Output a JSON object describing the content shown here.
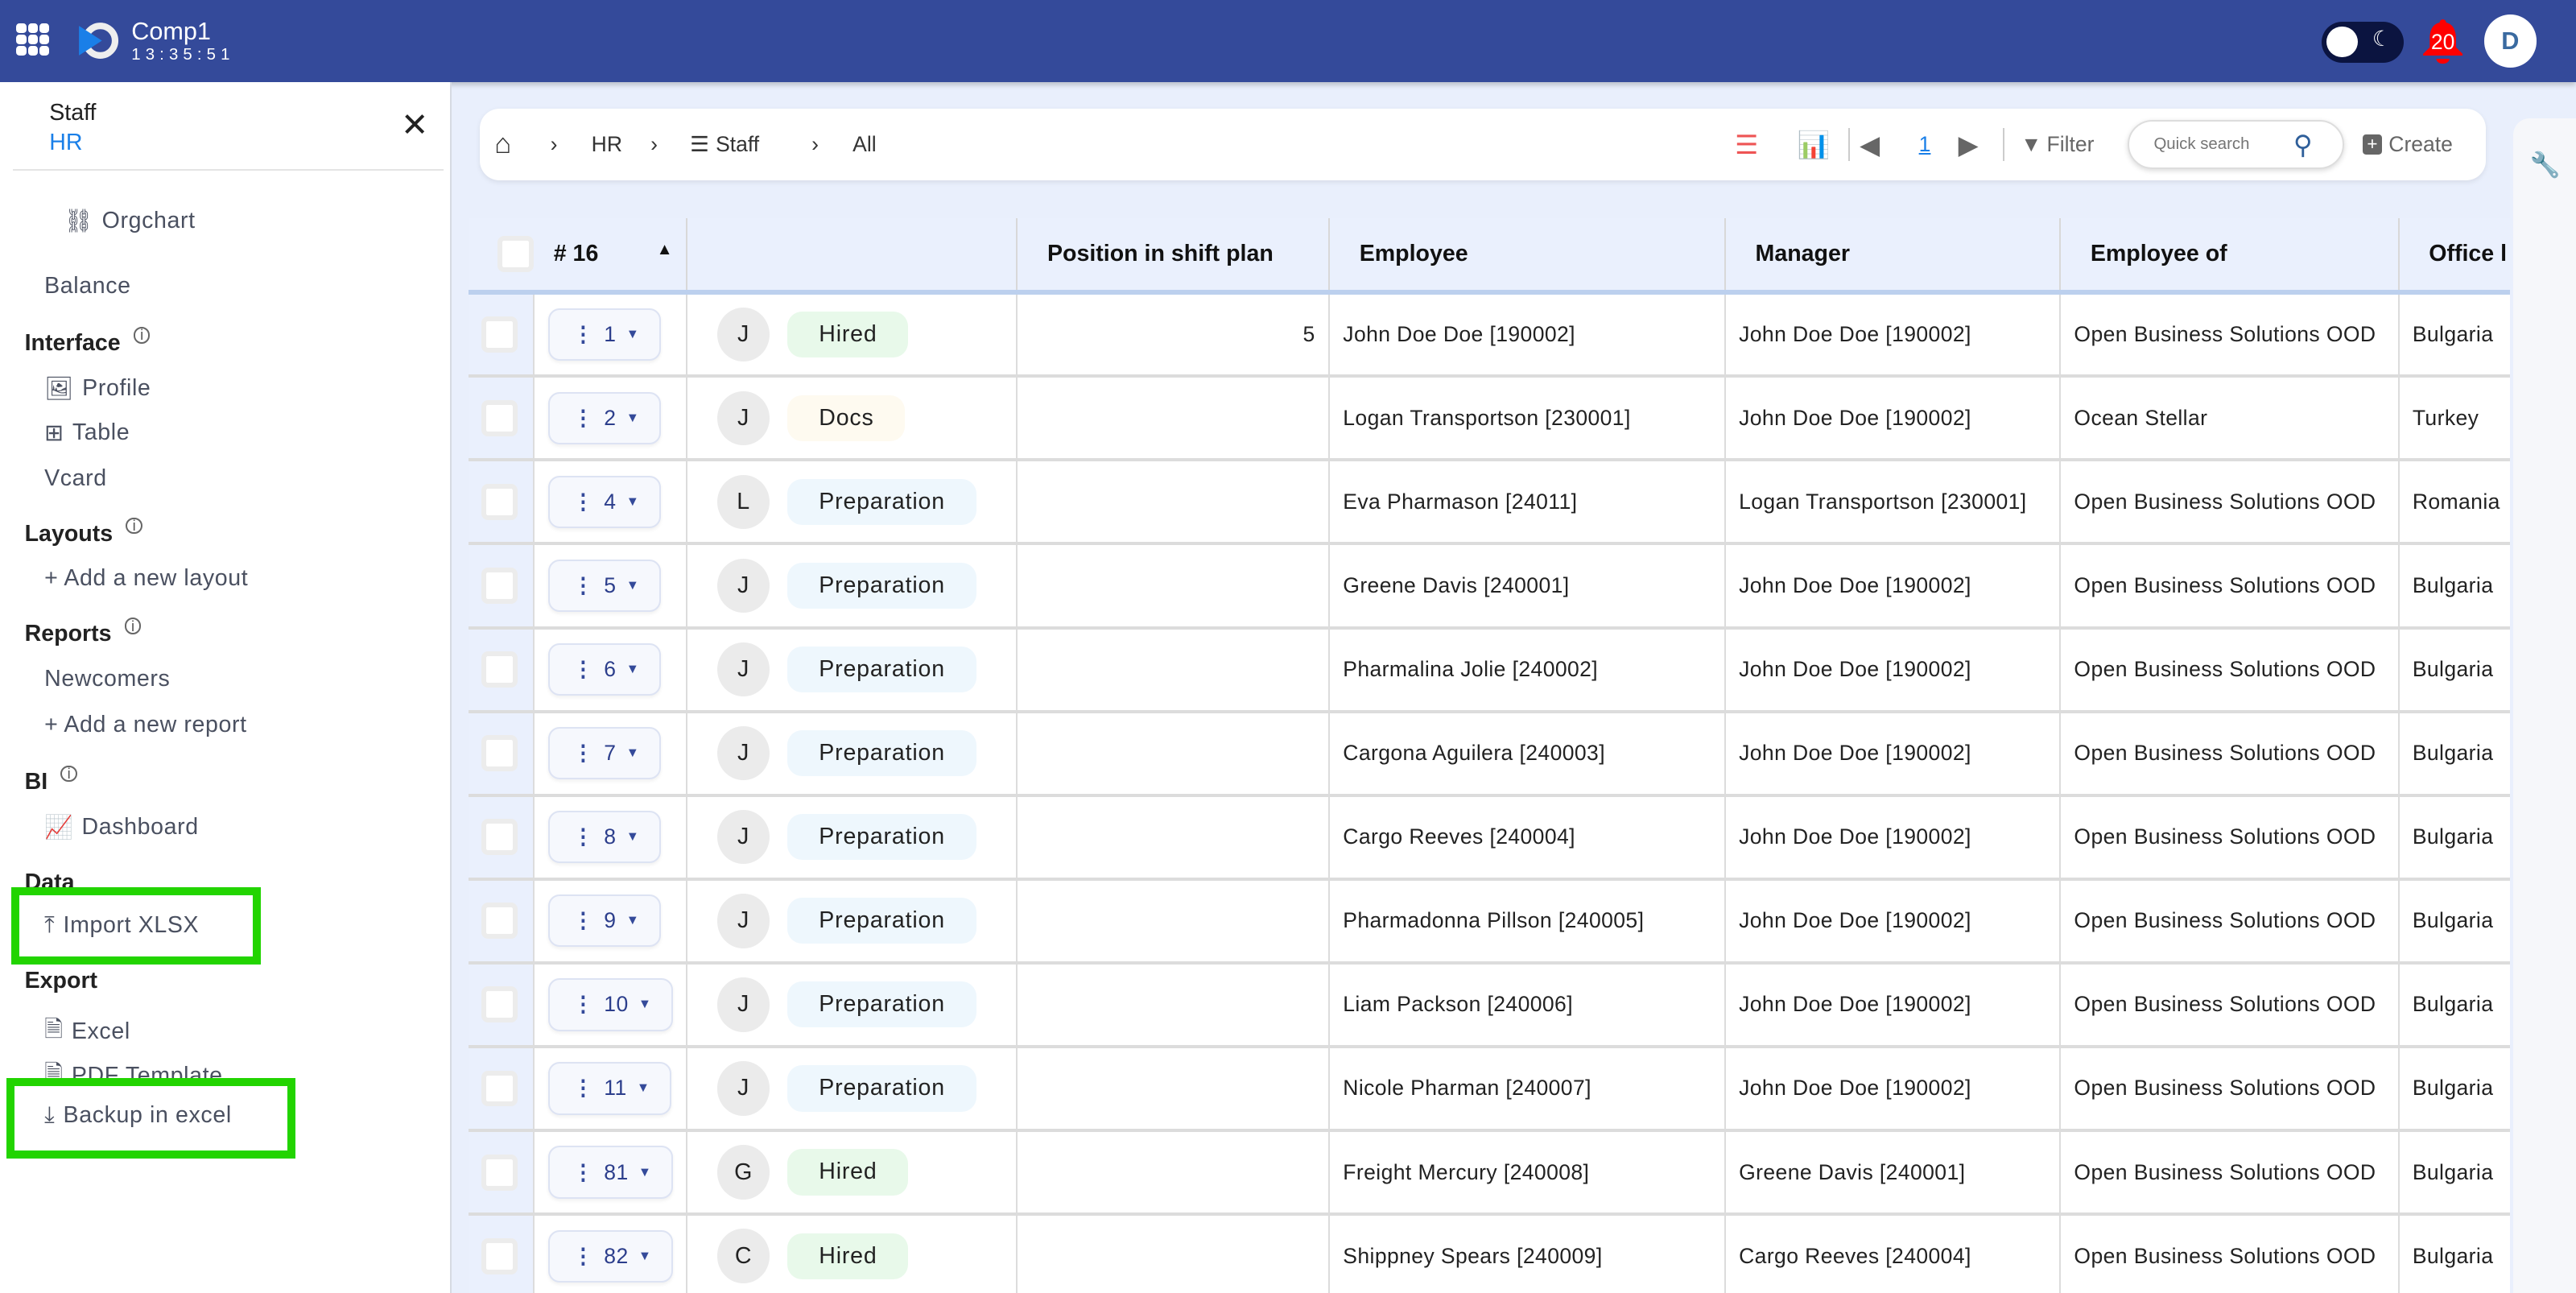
{
  "header": {
    "company": "Comp1",
    "clock": "13:35:51",
    "notifications": "20",
    "avatar": "D",
    "icons": [
      "apps-grid-icon",
      "logo-icon",
      "theme-toggle",
      "moon-icon",
      "bell-icon"
    ]
  },
  "sidebar": {
    "title": "Staff",
    "subtitle": "HR",
    "items": {
      "orgchart": "Orgchart",
      "balance": "Balance",
      "interface": "Interface",
      "profile": "Profile",
      "table": "Table",
      "vcard": "Vcard",
      "layouts": "Layouts",
      "add_layout": "+ Add a new layout",
      "reports": "Reports",
      "newcomers": "Newcomers",
      "add_report": "+ Add a new report",
      "bi": "BI",
      "dashboard": "Dashboard",
      "data": "Data",
      "import": "Import XLSX",
      "export": "Export",
      "excel": "Excel",
      "pdf": "PDF Template",
      "backup": "Backup in excel"
    }
  },
  "breadcrumb": {
    "hr": "HR",
    "staff": "Staff",
    "all": "All"
  },
  "toolbar": {
    "page": "1",
    "filter": "Filter",
    "search_placeholder": "Quick search",
    "create": "Create"
  },
  "table": {
    "count_header": "# 16",
    "columns": [
      "Position in shift plan",
      "Employee",
      "Manager",
      "Employee of",
      "Office l"
    ],
    "status_colors": {
      "Hired": "#e8f9ea",
      "Docs": "#fefaf0",
      "Preparation": "#eef7fd"
    },
    "rows": [
      {
        "num": "1",
        "initial": "J",
        "status": "Hired",
        "position": "5",
        "employee": "John Doe Doe [190002]",
        "manager": "John Doe Doe [190002]",
        "employer": "Open Business Solutions OOD",
        "office": "Bulgaria"
      },
      {
        "num": "2",
        "initial": "J",
        "status": "Docs",
        "position": "",
        "employee": "Logan Transportson [230001]",
        "manager": "John Doe Doe [190002]",
        "employer": "Ocean Stellar",
        "office": "Turkey"
      },
      {
        "num": "4",
        "initial": "L",
        "status": "Preparation",
        "position": "",
        "employee": "Eva Pharmason [24011]",
        "manager": "Logan Transportson [230001]",
        "employer": "Open Business Solutions OOD",
        "office": "Romania"
      },
      {
        "num": "5",
        "initial": "J",
        "status": "Preparation",
        "position": "",
        "employee": "Greene Davis [240001]",
        "manager": "John Doe Doe [190002]",
        "employer": "Open Business Solutions OOD",
        "office": "Bulgaria"
      },
      {
        "num": "6",
        "initial": "J",
        "status": "Preparation",
        "position": "",
        "employee": "Pharmalina Jolie [240002]",
        "manager": "John Doe Doe [190002]",
        "employer": "Open Business Solutions OOD",
        "office": "Bulgaria"
      },
      {
        "num": "7",
        "initial": "J",
        "status": "Preparation",
        "position": "",
        "employee": "Cargona Aguilera [240003]",
        "manager": "John Doe Doe [190002]",
        "employer": "Open Business Solutions OOD",
        "office": "Bulgaria"
      },
      {
        "num": "8",
        "initial": "J",
        "status": "Preparation",
        "position": "",
        "employee": "Cargo Reeves [240004]",
        "manager": "John Doe Doe [190002]",
        "employer": "Open Business Solutions OOD",
        "office": "Bulgaria"
      },
      {
        "num": "9",
        "initial": "J",
        "status": "Preparation",
        "position": "",
        "employee": "Pharmadonna Pillson [240005]",
        "manager": "John Doe Doe [190002]",
        "employer": "Open Business Solutions OOD",
        "office": "Bulgaria"
      },
      {
        "num": "10",
        "initial": "J",
        "status": "Preparation",
        "position": "",
        "employee": "Liam Packson [240006]",
        "manager": "John Doe Doe [190002]",
        "employer": "Open Business Solutions OOD",
        "office": "Bulgaria"
      },
      {
        "num": "11",
        "initial": "J",
        "status": "Preparation",
        "position": "",
        "employee": "Nicole Pharman [240007]",
        "manager": "John Doe Doe [190002]",
        "employer": "Open Business Solutions OOD",
        "office": "Bulgaria"
      },
      {
        "num": "81",
        "initial": "G",
        "status": "Hired",
        "position": "",
        "employee": "Freight Mercury [240008]",
        "manager": "Greene Davis [240001]",
        "employer": "Open Business Solutions OOD",
        "office": "Bulgaria"
      },
      {
        "num": "82",
        "initial": "C",
        "status": "Hired",
        "position": "",
        "employee": "Shippney Spears [240009]",
        "manager": "Cargo Reeves [240004]",
        "employer": "Open Business Solutions OOD",
        "office": "Bulgaria"
      }
    ]
  },
  "colors": {
    "header": "#344a9a",
    "highlight": "#22d400",
    "notification": "#ff0000",
    "link": "#1a7fe8"
  }
}
